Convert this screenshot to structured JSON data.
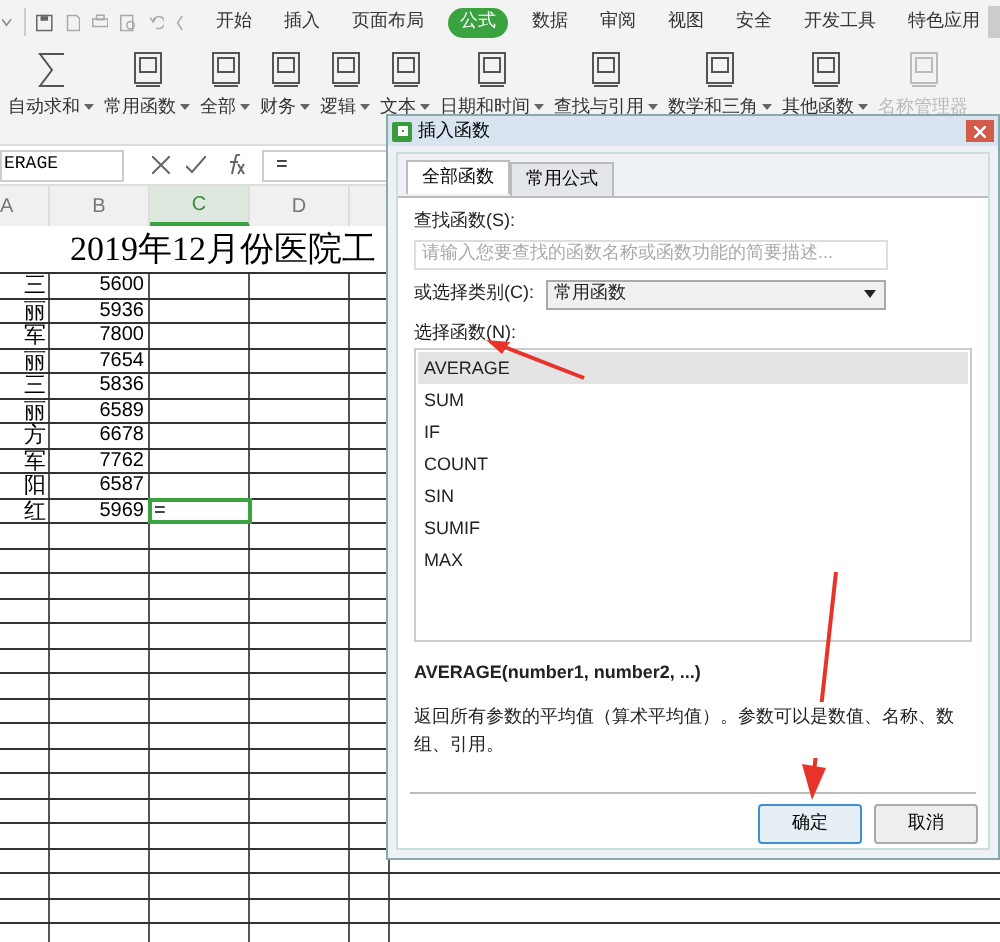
{
  "menu_tabs": [
    {
      "label": "开始",
      "selected": false
    },
    {
      "label": "插入",
      "selected": false
    },
    {
      "label": "页面布局",
      "selected": false
    },
    {
      "label": "公式",
      "selected": true
    },
    {
      "label": "数据",
      "selected": false
    },
    {
      "label": "审阅",
      "selected": false
    },
    {
      "label": "视图",
      "selected": false
    },
    {
      "label": "安全",
      "selected": false
    },
    {
      "label": "开发工具",
      "selected": false
    },
    {
      "label": "特色应用",
      "selected": false
    }
  ],
  "ribbon": [
    {
      "label": "自动求和",
      "kind": "sum",
      "disabled": false
    },
    {
      "label": "常用函数",
      "kind": "book",
      "disabled": false
    },
    {
      "label": "全部",
      "kind": "book",
      "disabled": false
    },
    {
      "label": "财务",
      "kind": "book",
      "disabled": false
    },
    {
      "label": "逻辑",
      "kind": "book",
      "disabled": false
    },
    {
      "label": "文本",
      "kind": "book",
      "disabled": false
    },
    {
      "label": "日期和时间",
      "kind": "book",
      "disabled": false
    },
    {
      "label": "查找与引用",
      "kind": "book",
      "disabled": false
    },
    {
      "label": "数学和三角",
      "kind": "book",
      "disabled": false
    },
    {
      "label": "其他函数",
      "kind": "book",
      "disabled": false
    },
    {
      "label": "名称管理器",
      "kind": "book",
      "disabled": true
    }
  ],
  "formula_bar": {
    "name_box": "ERAGE",
    "value": "="
  },
  "columns": [
    {
      "label": "A",
      "selected": false
    },
    {
      "label": "B",
      "selected": false
    },
    {
      "label": "C",
      "selected": true
    },
    {
      "label": "D",
      "selected": false
    }
  ],
  "sheet": {
    "title": "2019年12月份医院工",
    "rows": [
      {
        "name": "三",
        "amount": "5600",
        "formula": "",
        "selected": false
      },
      {
        "name": "丽",
        "amount": "5936",
        "formula": "",
        "selected": false
      },
      {
        "name": "军",
        "amount": "7800",
        "formula": "",
        "selected": false
      },
      {
        "name": "丽",
        "amount": "7654",
        "formula": "",
        "selected": false
      },
      {
        "name": "三",
        "amount": "5836",
        "formula": "",
        "selected": false
      },
      {
        "name": "丽",
        "amount": "6589",
        "formula": "",
        "selected": false
      },
      {
        "name": "方",
        "amount": "6678",
        "formula": "",
        "selected": false
      },
      {
        "name": "军",
        "amount": "7762",
        "formula": "",
        "selected": false
      },
      {
        "name": "阳",
        "amount": "6587",
        "formula": "",
        "selected": false
      },
      {
        "name": "红",
        "amount": "5969",
        "formula": "=",
        "selected": true
      }
    ]
  },
  "dialog": {
    "title": "插入函数",
    "tabs": [
      {
        "label": "全部函数",
        "selected": true
      },
      {
        "label": "常用公式",
        "selected": false
      }
    ],
    "search_label": "查找函数(S):",
    "search_placeholder": "请输入您要查找的函数名称或函数功能的简要描述...",
    "category_label": "或选择类别(C):",
    "category": "常用函数",
    "list_label": "选择函数(N):",
    "functions": [
      {
        "name": "AVERAGE",
        "selected": true
      },
      {
        "name": "SUM",
        "selected": false
      },
      {
        "name": "IF",
        "selected": false
      },
      {
        "name": "COUNT",
        "selected": false
      },
      {
        "name": "SIN",
        "selected": false
      },
      {
        "name": "SUMIF",
        "selected": false
      },
      {
        "name": "MAX",
        "selected": false
      }
    ],
    "signature": "AVERAGE(number1, number2, ...)",
    "description": "返回所有参数的平均值（算术平均值）。参数可以是数值、名称、数组、引用。",
    "buttons": [
      {
        "label": "确定",
        "selected": true
      },
      {
        "label": "取消",
        "selected": false
      }
    ]
  }
}
